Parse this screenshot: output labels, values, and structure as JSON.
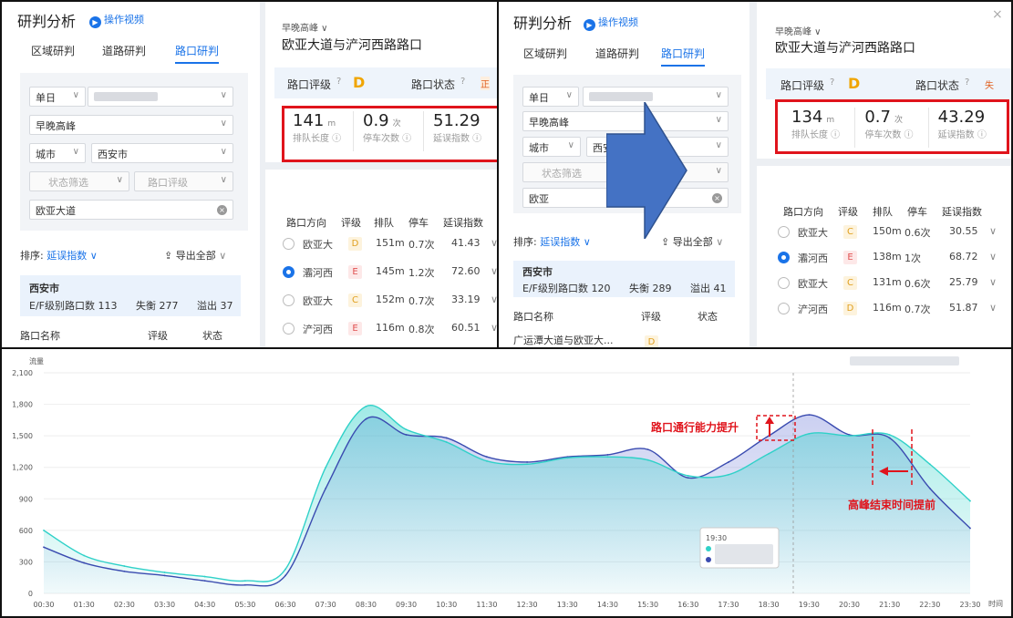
{
  "left_app": {
    "title": "研判分析",
    "video_link": "操作视频",
    "tabs": [
      "区域研判",
      "道路研判",
      "路口研判"
    ],
    "filter_date_mode": "单日",
    "filter_peak": "早晚高峰",
    "filter_scope": "城市",
    "filter_city": "西安市",
    "filter_status": "状态筛选",
    "filter_grade": "路口评级",
    "search_value_1": "欧亚大道",
    "search_value_2": "欧亚",
    "sort_label": "排序:",
    "sort_value": "延误指数",
    "export_label": "导出全部",
    "info_city": "西安市",
    "info_line_1": "E/F级别路口数 113",
    "info_balance_1": "失衡 277",
    "info_overflow_1": "溢出 37",
    "info_line_2": "E/F级别路口数 120",
    "info_balance_2": "失衡 289",
    "info_overflow_2": "溢出 41",
    "col_name": "路口名称",
    "col_grade": "评级",
    "col_status": "状态",
    "list_first_name": "广运潭大道与欧亚大...",
    "list_first_grade": "D"
  },
  "right_panel": {
    "period": "早晚高峰",
    "intersection": "欧亚大道与浐河西路路口",
    "grade_label": "路口评级",
    "grade_value": "D",
    "status_label": "路口状态",
    "status_value_1": "正",
    "status_value_2": "失",
    "metric_labels": [
      "排队长度",
      "停车次数",
      "延误指数"
    ],
    "metric_units": [
      "m",
      "次"
    ],
    "before": {
      "queue": "141",
      "stops": "0.9",
      "delay": "51.29"
    },
    "after": {
      "queue": "134",
      "stops": "0.7",
      "delay": "43.29"
    },
    "table_headers": [
      "路口方向",
      "评级",
      "排队",
      "停车",
      "延误指数"
    ],
    "before_rows": [
      {
        "dir": "欧亚大",
        "grade": "D",
        "queue": "151m",
        "stop": "0.7次",
        "delay": "41.43"
      },
      {
        "dir": "灞河西",
        "grade": "E",
        "queue": "145m",
        "stop": "1.2次",
        "delay": "72.60"
      },
      {
        "dir": "欧亚大",
        "grade": "C",
        "queue": "152m",
        "stop": "0.7次",
        "delay": "33.19"
      },
      {
        "dir": "浐河西",
        "grade": "E",
        "queue": "116m",
        "stop": "0.8次",
        "delay": "60.51"
      }
    ],
    "after_rows": [
      {
        "dir": "欧亚大",
        "grade": "C",
        "queue": "150m",
        "stop": "0.6次",
        "delay": "30.55"
      },
      {
        "dir": "灞河西",
        "grade": "E",
        "queue": "138m",
        "stop": "1次",
        "delay": "68.72"
      },
      {
        "dir": "欧亚大",
        "grade": "C",
        "queue": "131m",
        "stop": "0.6次",
        "delay": "25.79"
      },
      {
        "dir": "浐河西",
        "grade": "D",
        "queue": "116m",
        "stop": "0.7次",
        "delay": "51.87"
      }
    ]
  },
  "colors": {
    "accent": "#1a73e8",
    "highlight": "#e0141c",
    "arrow": "#4472c4",
    "teal": "#2fd1c8",
    "navy": "#3a4bb0"
  },
  "chart_data": {
    "type": "area",
    "ylabel": "流量",
    "xlabel": "时间",
    "ylim": [
      0,
      2100
    ],
    "yticks": [
      0,
      300,
      600,
      900,
      1200,
      1500,
      1800,
      2100
    ],
    "x": [
      "00:30",
      "01:30",
      "02:30",
      "03:30",
      "04:30",
      "05:30",
      "06:30",
      "07:30",
      "08:30",
      "09:30",
      "10:30",
      "11:30",
      "12:30",
      "13:30",
      "14:30",
      "15:30",
      "16:30",
      "17:30",
      "18:30",
      "19:30",
      "20:30",
      "21:30",
      "22:30",
      "23:30"
    ],
    "series": [
      {
        "values": [
          600,
          360,
          260,
          200,
          160,
          120,
          230,
          1200,
          1780,
          1560,
          1440,
          1260,
          1230,
          1290,
          1300,
          1270,
          1120,
          1130,
          1330,
          1520,
          1500,
          1510,
          1230,
          880
        ]
      },
      {
        "values": [
          440,
          290,
          210,
          170,
          120,
          80,
          170,
          1000,
          1660,
          1510,
          1480,
          1300,
          1250,
          1300,
          1320,
          1370,
          1100,
          1250,
          1500,
          1700,
          1510,
          1480,
          1000,
          620
        ]
      }
    ],
    "tooltip_time": "19:30",
    "annotations": [
      "路口通行能力提升",
      "高峰结束时间提前"
    ]
  }
}
